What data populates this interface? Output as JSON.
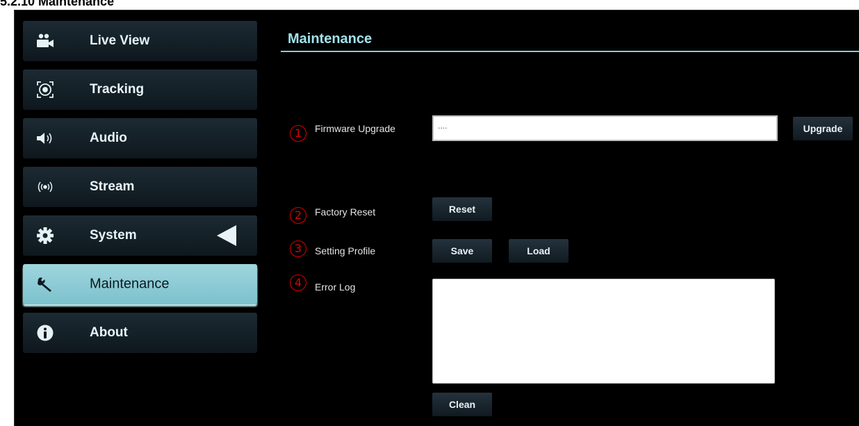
{
  "doc_heading": "5.2.10 Maintenance",
  "sidebar": {
    "items": [
      {
        "label": "Live View",
        "icon": "video-camera-icon",
        "active": false
      },
      {
        "label": "Tracking",
        "icon": "tracking-target-icon",
        "active": false
      },
      {
        "label": "Audio",
        "icon": "speaker-icon",
        "active": false
      },
      {
        "label": "Stream",
        "icon": "broadcast-icon",
        "active": false
      },
      {
        "label": "System",
        "icon": "gear-icon",
        "active": false
      },
      {
        "label": "Maintenance",
        "icon": "wrench-icon",
        "active": true
      },
      {
        "label": "About",
        "icon": "info-icon",
        "active": false
      }
    ]
  },
  "main": {
    "title": "Maintenance",
    "firmware": {
      "number": "1",
      "label": "Firmware Upgrade",
      "input_value": "....",
      "button": "Upgrade"
    },
    "factory_reset": {
      "number": "2",
      "label": "Factory Reset",
      "button": "Reset"
    },
    "setting_profile": {
      "number": "3",
      "label": "Setting Profile",
      "save_button": "Save",
      "load_button": "Load"
    },
    "error_log": {
      "number": "4",
      "label": "Error Log",
      "value": "",
      "clean_button": "Clean"
    }
  },
  "colors": {
    "background": "#000000",
    "accent": "#9fe3ee",
    "active_nav": "#8ccbd5",
    "annotation": "#e00000"
  }
}
